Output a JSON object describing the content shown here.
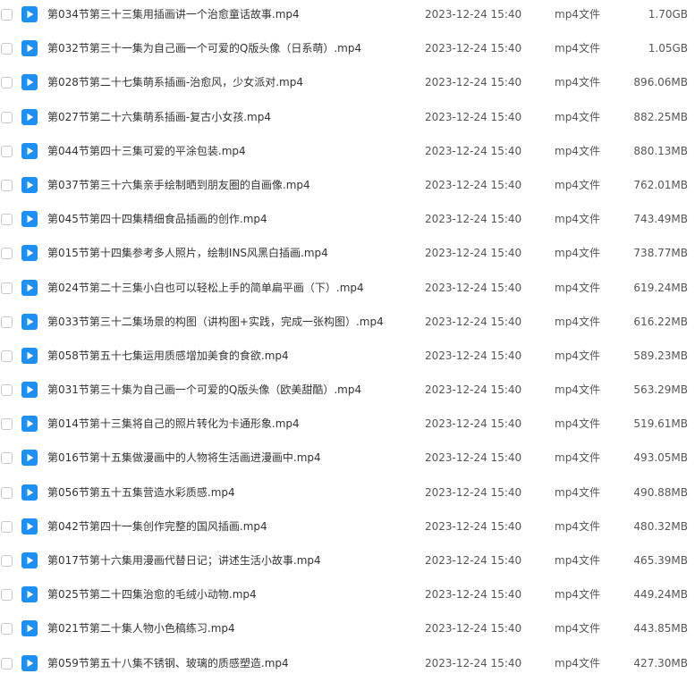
{
  "colors": {
    "icon_bg": "#1e90f5",
    "text_primary": "#333333",
    "text_secondary": "#555555",
    "checkbox_border": "#c7c9cc"
  },
  "file_icon": "video-file-icon",
  "files": [
    {
      "name": "第034节第三十三集用插画讲一个治愈童话故事.mp4",
      "date": "2023-12-24 15:40",
      "type": "mp4文件",
      "size": "1.70GB"
    },
    {
      "name": "第032节第三十一集为自己画一个可爱的Q版头像（日系萌）.mp4",
      "date": "2023-12-24 15:40",
      "type": "mp4文件",
      "size": "1.05GB"
    },
    {
      "name": "第028节第二十七集萌系插画-治愈风，少女派对.mp4",
      "date": "2023-12-24 15:40",
      "type": "mp4文件",
      "size": "896.06MB"
    },
    {
      "name": "第027节第二十六集萌系插画-复古小女孩.mp4",
      "date": "2023-12-24 15:40",
      "type": "mp4文件",
      "size": "882.25MB"
    },
    {
      "name": "第044节第四十三集可爱的平涂包装.mp4",
      "date": "2023-12-24 15:40",
      "type": "mp4文件",
      "size": "880.13MB"
    },
    {
      "name": "第037节第三十六集亲手绘制晒到朋友圈的自画像.mp4",
      "date": "2023-12-24 15:40",
      "type": "mp4文件",
      "size": "762.01MB"
    },
    {
      "name": "第045节第四十四集精细食品插画的创作.mp4",
      "date": "2023-12-24 15:40",
      "type": "mp4文件",
      "size": "743.49MB"
    },
    {
      "name": "第015节第十四集参考多人照片，绘制INS风黑白插画.mp4",
      "date": "2023-12-24 15:40",
      "type": "mp4文件",
      "size": "738.77MB"
    },
    {
      "name": "第024节第二十三集小白也可以轻松上手的简单扁平画（下）.mp4",
      "date": "2023-12-24 15:40",
      "type": "mp4文件",
      "size": "619.24MB"
    },
    {
      "name": "第033节第三十二集场景的构图（讲构图+实践，完成一张构图）.mp4",
      "date": "2023-12-24 15:40",
      "type": "mp4文件",
      "size": "616.22MB"
    },
    {
      "name": "第058节第五十七集运用质感增加美食的食欲.mp4",
      "date": "2023-12-24 15:40",
      "type": "mp4文件",
      "size": "589.23MB"
    },
    {
      "name": "第031节第三十集为自己画一个可爱的Q版头像（欧美甜酷）.mp4",
      "date": "2023-12-24 15:40",
      "type": "mp4文件",
      "size": "563.29MB"
    },
    {
      "name": "第014节第十三集将自己的照片转化为卡通形象.mp4",
      "date": "2023-12-24 15:40",
      "type": "mp4文件",
      "size": "519.61MB"
    },
    {
      "name": "第016节第十五集做漫画中的人物将生活画进漫画中.mp4",
      "date": "2023-12-24 15:40",
      "type": "mp4文件",
      "size": "493.05MB"
    },
    {
      "name": "第056节第五十五集营造水彩质感.mp4",
      "date": "2023-12-24 15:40",
      "type": "mp4文件",
      "size": "490.88MB"
    },
    {
      "name": "第042节第四十一集创作完整的国风插画.mp4",
      "date": "2023-12-24 15:40",
      "type": "mp4文件",
      "size": "480.32MB"
    },
    {
      "name": "第017节第十六集用漫画代替日记；讲述生活小故事.mp4",
      "date": "2023-12-24 15:40",
      "type": "mp4文件",
      "size": "465.39MB"
    },
    {
      "name": "第025节第二十四集治愈的毛绒小动物.mp4",
      "date": "2023-12-24 15:40",
      "type": "mp4文件",
      "size": "449.24MB"
    },
    {
      "name": "第021节第二十集人物小色稿练习.mp4",
      "date": "2023-12-24 15:40",
      "type": "mp4文件",
      "size": "443.85MB"
    },
    {
      "name": "第059节第五十八集不锈钢、玻璃的质感塑造.mp4",
      "date": "2023-12-24 15:40",
      "type": "mp4文件",
      "size": "427.30MB"
    }
  ]
}
